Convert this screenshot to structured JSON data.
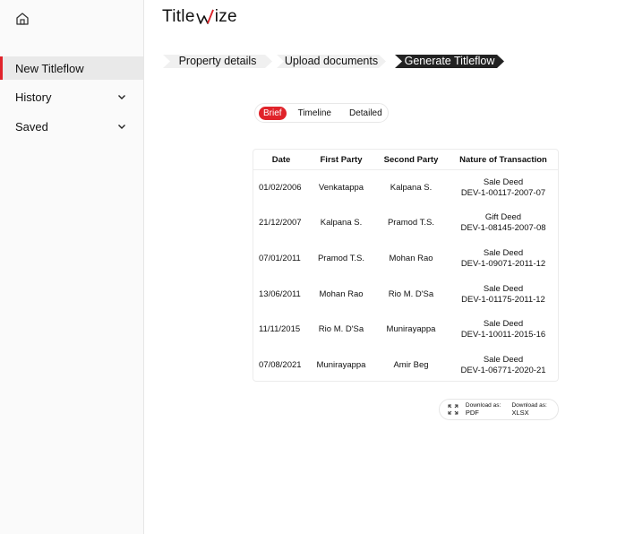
{
  "app": {
    "logo_prefix": "Title",
    "logo_suffix": "ize"
  },
  "sidebar": {
    "items": [
      {
        "label": "New Titleflow"
      },
      {
        "label": "History"
      },
      {
        "label": "Saved"
      }
    ]
  },
  "steps": [
    {
      "label": "Property details"
    },
    {
      "label": "Upload documents"
    },
    {
      "label": "Generate Titleflow"
    }
  ],
  "tabs": [
    {
      "label": "Brief"
    },
    {
      "label": "Timeline"
    },
    {
      "label": "Detailed"
    }
  ],
  "table": {
    "headers": [
      "Date",
      "First Party",
      "Second Party",
      "Nature of Transaction"
    ],
    "rows": [
      {
        "date": "01/02/2006",
        "first": "Venkatappa",
        "second": "Kalpana S.",
        "type": "Sale Deed",
        "doc": "DEV-1-00117-2007-07"
      },
      {
        "date": "21/12/2007",
        "first": "Kalpana S.",
        "second": "Pramod T.S.",
        "type": "Gift Deed",
        "doc": "DEV-1-08145-2007-08"
      },
      {
        "date": "07/01/2011",
        "first": "Pramod T.S.",
        "second": "Mohan Rao",
        "type": "Sale Deed",
        "doc": "DEV-1-09071-2011-12"
      },
      {
        "date": "13/06/2011",
        "first": "Mohan Rao",
        "second": "Rio M. D'Sa",
        "type": "Sale Deed",
        "doc": "DEV-1-01175-2011-12"
      },
      {
        "date": "11/11/2015",
        "first": "Rio M. D'Sa",
        "second": "Munirayappa",
        "type": "Sale Deed",
        "doc": "DEV-1-10011-2015-16"
      },
      {
        "date": "07/08/2021",
        "first": "Munirayappa",
        "second": "Amir Beg",
        "type": "Sale Deed",
        "doc": "DEV-1-06771-2020-21"
      }
    ]
  },
  "download": {
    "label": "Download as:",
    "formats": [
      "PDF",
      "XLSX"
    ]
  },
  "colors": {
    "accent": "#e0232a",
    "active_step": "#222222",
    "inactive_step": "#f0f0f0"
  },
  "icons": {
    "home": "home-icon",
    "chevron": "chevron-down-icon",
    "expand": "expand-icon"
  }
}
